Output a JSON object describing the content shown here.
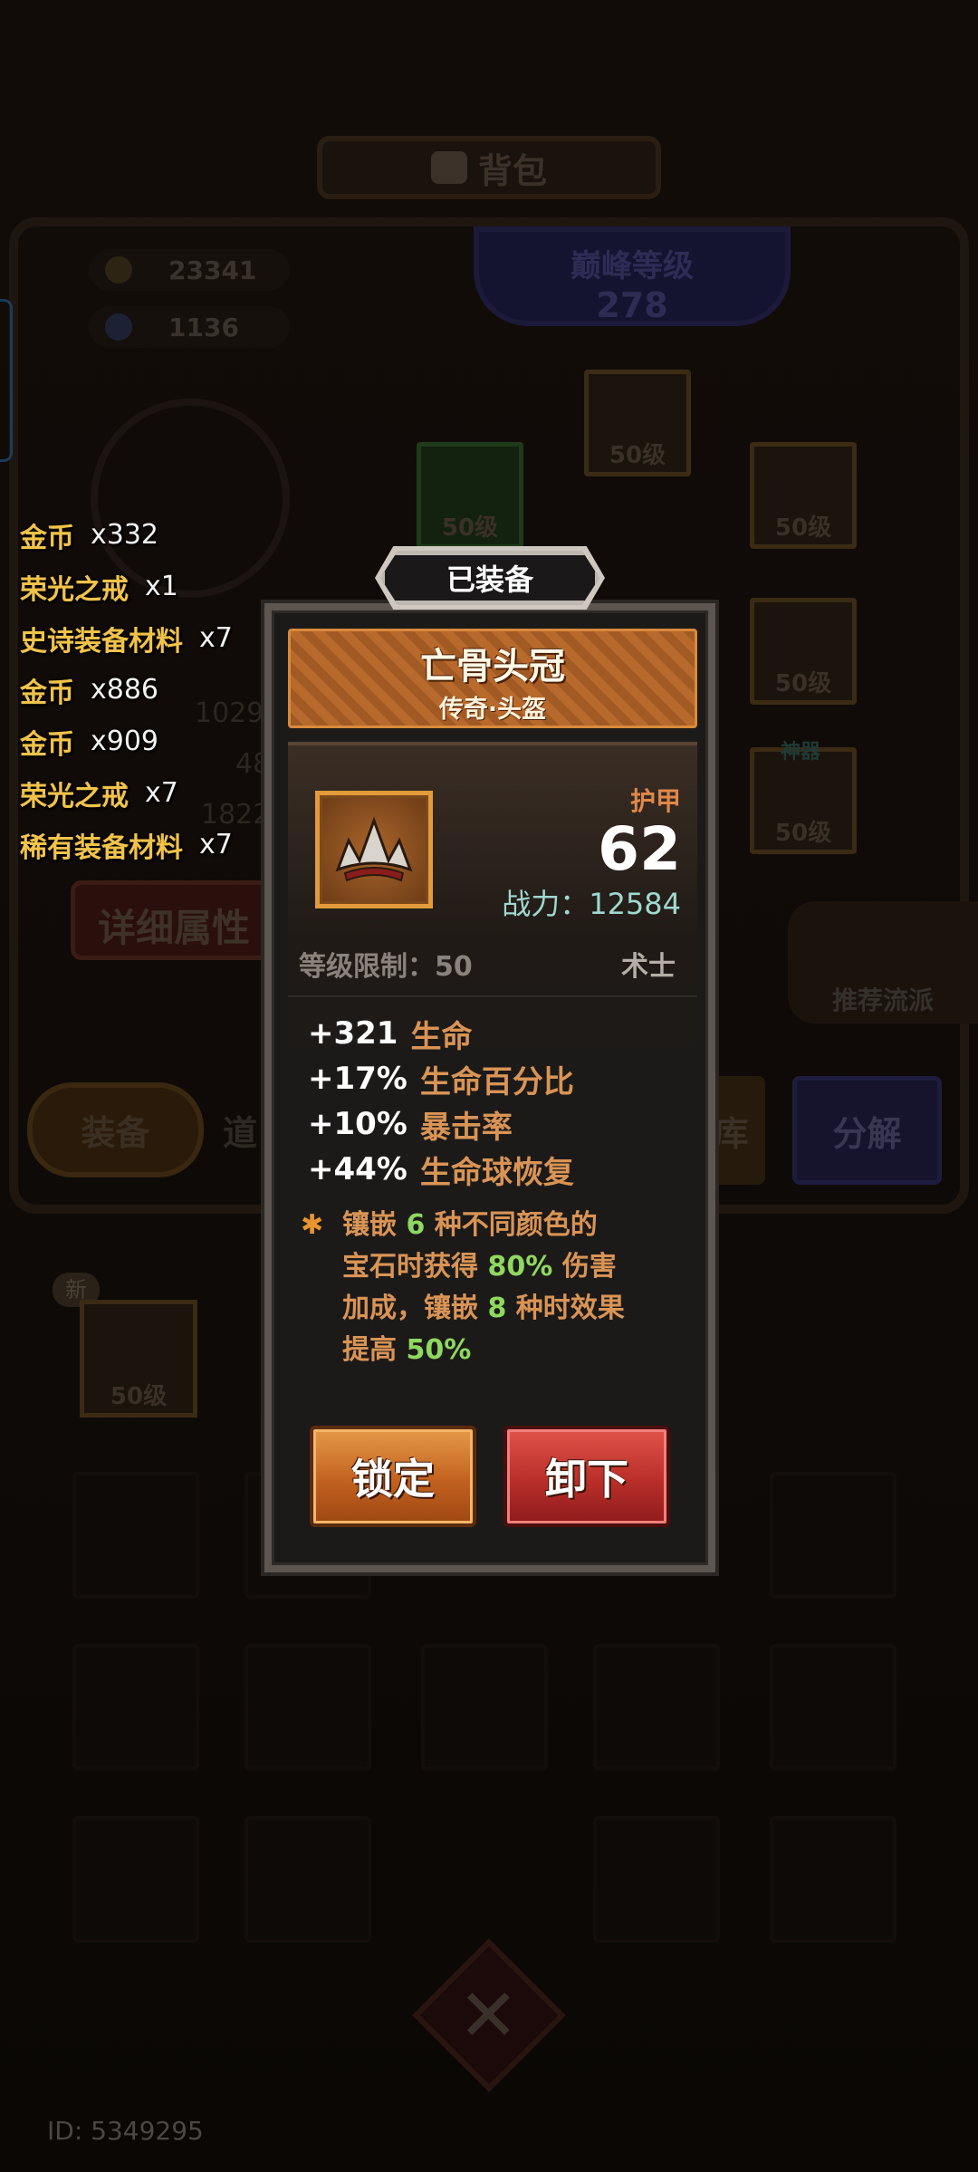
{
  "background": {
    "title": "背包",
    "gold": "23341",
    "gems": "1136",
    "peak_label": "巅峰等级",
    "peak_level": "278",
    "slot_level": "50级",
    "god_tag": "神器",
    "detail_button": "详细属性",
    "recommend_button": "推荐流派",
    "tabs": {
      "equipment": "装备",
      "items": "道",
      "warehouse": "库",
      "decompose": "分解"
    },
    "new_tag": "新",
    "stat_values": [
      "1029",
      "48",
      "1822"
    ],
    "player_id": "ID: 5349295"
  },
  "loot_feed": [
    {
      "name": "金币",
      "qty": "x332"
    },
    {
      "name": "荣光之戒",
      "qty": "x1"
    },
    {
      "name": "史诗装备材料",
      "qty": "x7"
    },
    {
      "name": "金币",
      "qty": "x886"
    },
    {
      "name": "金币",
      "qty": "x909"
    },
    {
      "name": "荣光之戒",
      "qty": "x7"
    },
    {
      "name": "稀有装备材料",
      "qty": "x7"
    }
  ],
  "popup": {
    "status_tag": "已装备",
    "item_name": "亡骨头冠",
    "item_subtitle": "传奇·头盔",
    "armor_label": "护甲",
    "armor_value": "62",
    "power_label": "战力：",
    "power_value": "12584",
    "level_limit_label": "等级限制：",
    "level_limit_value": "50",
    "class_name": "术士",
    "stats": [
      {
        "value": "+321",
        "name": "生命"
      },
      {
        "value": "+17%",
        "name": "生命百分比"
      },
      {
        "value": "+10%",
        "name": "暴击率"
      },
      {
        "value": "+44%",
        "name": "生命球恢复"
      }
    ],
    "set_bonus": {
      "star": "✱",
      "p1": "镶嵌",
      "n1": "6",
      "p2": "种不同颜色的",
      "p3": "宝石时获得",
      "n2": "80%",
      "p4": "伤害",
      "p5": "加成，镶嵌",
      "n3": "8",
      "p6": "种时效果",
      "p7": "提高",
      "n4": "50%"
    },
    "lock_button": "锁定",
    "unequip_button": "卸下"
  },
  "colors": {
    "loot_name": "#f1c34a",
    "header_orange": "#b0642a",
    "stat_orange": "#d99455",
    "highlight_green": "#8fd860",
    "power_teal": "#9fd8cf",
    "lock_button": "#c2611f",
    "unequip_button": "#b92e2a"
  }
}
